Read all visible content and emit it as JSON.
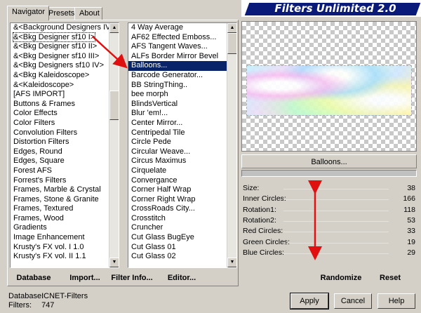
{
  "tabs": [
    {
      "label": "Navigator"
    },
    {
      "label": "Presets"
    },
    {
      "label": "About"
    }
  ],
  "banner": {
    "title": "Filters Unlimited 2.0"
  },
  "categories": [
    "&<Background Designers IV>",
    "&<Bkg Designer sf10 I>",
    "&<Bkg Designer sf10 II>",
    "&<Bkg Designer sf10 III>",
    "&<Bkg Designers sf10 IV>",
    "&<Bkg Kaleidoscope>",
    "&<Kaleidoscope>",
    "[AFS IMPORT]",
    "Buttons & Frames",
    "Color Effects",
    "Color Filters",
    "Convolution Filters",
    "Distortion Filters",
    "Edges, Round",
    "Edges, Square",
    "Forest AFS",
    "Forrest's Filters",
    "Frames, Marble & Crystal",
    "Frames, Stone & Granite",
    "Frames, Textured",
    "Frames, Wood",
    "Gradients",
    "Image Enhancement",
    "Krusty's FX vol. I 1.0",
    "Krusty's FX vol. II 1.1"
  ],
  "filters": [
    "4 Way Average",
    "AF62 Effected Emboss...",
    "AFS Tangent Waves...",
    "ALFs Border Mirror Bevel",
    "Balloons...",
    "Barcode Generator...",
    "BB StringThing..",
    "bee morph",
    "BlindsVertical",
    "Blur 'em!...",
    "Center Mirror...",
    "Centripedal Tile",
    "Circle Pede",
    "Circular Weave...",
    "Circus Maximus",
    "Cirquelate",
    "Convergance",
    "Corner Half Wrap",
    "Corner Right Wrap",
    "CrossRoads City...",
    "Crosstitch",
    "Cruncher",
    "Cut Glass  BugEye",
    "Cut Glass 01",
    "Cut Glass 02"
  ],
  "selected_category_index": 1,
  "selected_filter_index": 4,
  "list_buttons": {
    "database": "Database",
    "import": "Import...",
    "filter_info": "Filter Info...",
    "editor": "Editor..."
  },
  "preview": {
    "filter_name": "Balloons..."
  },
  "params": [
    {
      "label": "Size:",
      "value": "38"
    },
    {
      "label": "Inner Circles:",
      "value": "166"
    },
    {
      "label": "Rotation1:",
      "value": "118"
    },
    {
      "label": "Rotation2:",
      "value": "53"
    },
    {
      "label": "Red Circles:",
      "value": "33"
    },
    {
      "label": "Green Circles:",
      "value": "19"
    },
    {
      "label": "Blue Circles:",
      "value": "29"
    }
  ],
  "param_buttons": {
    "randomize": "Randomize",
    "reset": "Reset"
  },
  "status": {
    "database_label": "Database:",
    "database_value": "ICNET-Filters",
    "filters_label": "Filters:",
    "filters_value": "747"
  },
  "dialog_buttons": {
    "apply": "Apply",
    "cancel": "Cancel",
    "help": "Help"
  },
  "colors": {
    "selection": "#0a246a",
    "banner": "#0a1a78",
    "annotation_arrow": "#e01010"
  }
}
